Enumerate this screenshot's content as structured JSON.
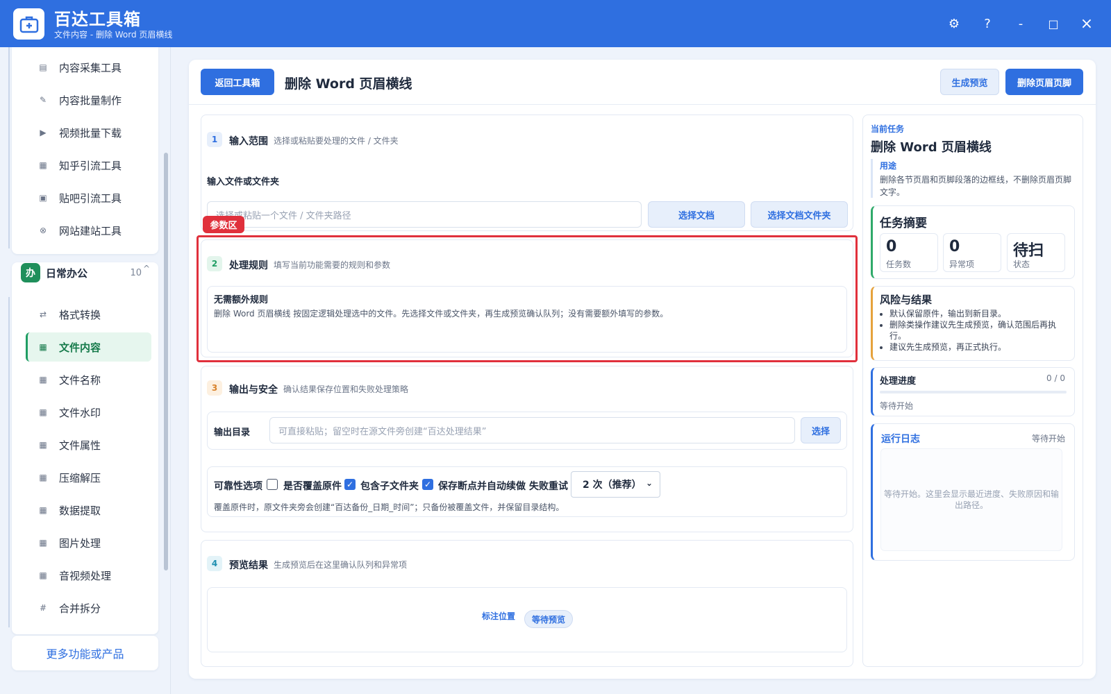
{
  "app": {
    "title": "百达工具箱",
    "subtitle": "文件内容 - 删除 Word 页眉横线",
    "controls": {
      "settings": "⚙",
      "help": "?",
      "minimize": "-",
      "maximize": "□",
      "close": "×"
    }
  },
  "sidebar": {
    "top_items": [
      {
        "label": "内容采集工具",
        "icon": "document-icon"
      },
      {
        "label": "内容批量制作",
        "icon": "pen-icon"
      },
      {
        "label": "视频批量下载",
        "icon": "video-icon"
      },
      {
        "label": "知乎引流工具",
        "icon": "zhihu-icon"
      },
      {
        "label": "贴吧引流工具",
        "icon": "tieba-icon"
      },
      {
        "label": "网站建站工具",
        "icon": "globe-icon"
      }
    ],
    "group": {
      "badge": "办",
      "name": "日常办公",
      "count": "10",
      "caret": "^"
    },
    "office_items": [
      {
        "label": "格式转换",
        "icon": "swap-icon"
      },
      {
        "label": "文件内容",
        "icon": "grid-icon",
        "active": true
      },
      {
        "label": "文件名称",
        "icon": "grid-icon"
      },
      {
        "label": "文件水印",
        "icon": "grid-icon"
      },
      {
        "label": "文件属性",
        "icon": "grid-icon"
      },
      {
        "label": "压缩解压",
        "icon": "grid-icon"
      },
      {
        "label": "数据提取",
        "icon": "grid-icon"
      },
      {
        "label": "图片处理",
        "icon": "grid-icon"
      },
      {
        "label": "音视频处理",
        "icon": "grid-icon"
      },
      {
        "label": "合并拆分",
        "icon": "hash-icon"
      }
    ],
    "more_label": "更多功能或产品"
  },
  "header": {
    "back_label": "返回工具箱",
    "title": "删除 Word 页眉横线",
    "preview_label": "生成预览",
    "run_label": "删除页眉页脚"
  },
  "step1": {
    "num": "1",
    "title": "输入范围",
    "desc": "选择或粘贴要处理的文件 / 文件夹",
    "field_label": "输入文件或文件夹",
    "placeholder": "选择或粘贴一个文件 / 文件夹路径",
    "btn_file": "选择文档",
    "btn_folder": "选择文档文件夹"
  },
  "highlight_tag": "参数区",
  "step2": {
    "num": "2",
    "title": "处理规则",
    "desc": "填写当前功能需要的规则和参数",
    "rule_title": "无需额外规则",
    "rule_text": "删除 Word 页眉横线 按固定逻辑处理选中的文件。先选择文件或文件夹，再生成预览确认队列；没有需要额外填写的参数。"
  },
  "step3": {
    "num": "3",
    "title": "输出与安全",
    "desc": "确认结果保存位置和失败处理策略",
    "output_label": "输出目录",
    "output_placeholder": "可直接粘贴；留空时在源文件旁创建“百达处理结果”",
    "output_btn": "选择",
    "reliability_label": "可靠性选项",
    "opt_overwrite": "是否覆盖原件",
    "opt_overwrite_checked": false,
    "opt_subfolder": "包含子文件夹",
    "opt_subfolder_checked": true,
    "opt_resume": "保存断点并自动续做",
    "opt_resume_checked": true,
    "retry_label": "失败重试",
    "retry_value": "2 次（推荐）",
    "note": "覆盖原件时，原文件夹旁会创建“百达备份_日期_时间”；只备份被覆盖文件，并保留目录结构。"
  },
  "step4": {
    "num": "4",
    "title": "预览结果",
    "desc": "生成预览后在这里确认队列和异常项",
    "mark_label": "标注位置",
    "status_badge": "等待预览"
  },
  "right": {
    "current_task_label": "当前任务",
    "task_title": "删除 Word 页眉横线",
    "usage_label": "用途",
    "usage_text": "删除各节页眉和页脚段落的边框线，不删除页眉页脚文字。",
    "summary_title": "任务摘要",
    "stats": [
      {
        "value": "0",
        "label": "任务数"
      },
      {
        "value": "0",
        "label": "异常项"
      },
      {
        "value": "待扫",
        "label": "状态"
      }
    ],
    "risk_title": "风险与结果",
    "risks": [
      "默认保留原件，输出到新目录。",
      "删除类操作建议先生成预览，确认范围后再执行。",
      "建议先生成预览，再正式执行。"
    ],
    "progress_title": "处理进度",
    "progress_count": "0 / 0",
    "progress_value": 0,
    "progress_status": "等待开始",
    "log_title": "运行日志",
    "log_status": "等待开始",
    "log_text": "等待开始。这里会显示最近进度、失败原因和输出路径。"
  },
  "colors": {
    "brand": "#2f6fe0",
    "active_green": "#1f9d63",
    "highlight_red": "#e0303c"
  }
}
